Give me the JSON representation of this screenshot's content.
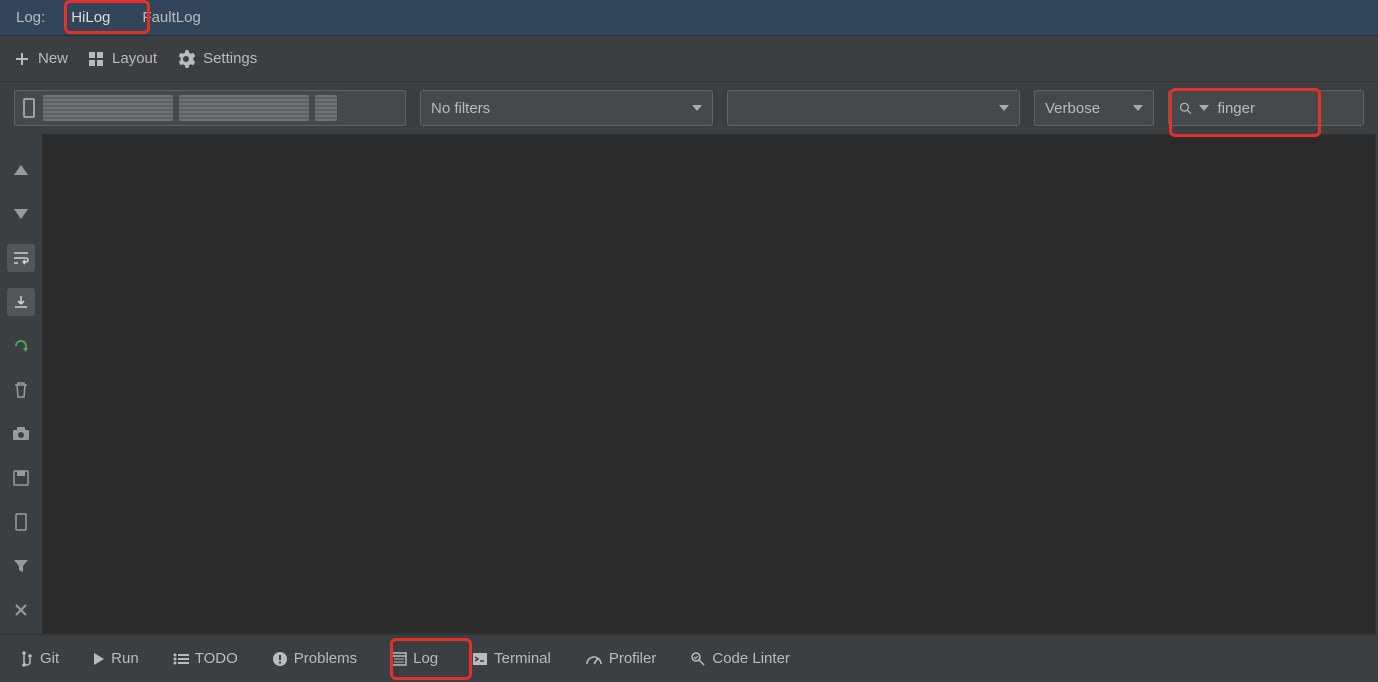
{
  "tabbar": {
    "label": "Log:",
    "tabs": [
      {
        "label": "HiLog",
        "active": true
      },
      {
        "label": "FaultLog",
        "active": false
      }
    ]
  },
  "toolbar": {
    "new_label": "New",
    "layout_label": "Layout",
    "settings_label": "Settings"
  },
  "filters": {
    "no_filters_label": "No filters",
    "verbose_label": "Verbose",
    "search_value": "finger"
  },
  "left_tools": {
    "icons": [
      "arrow-up-icon",
      "arrow-down-icon",
      "wrap-icon",
      "export-icon",
      "refresh-icon",
      "trash-icon",
      "camera-icon",
      "save-icon",
      "device-icon",
      "filter-icon",
      "close-icon"
    ]
  },
  "bottombar": {
    "git": "Git",
    "run": "Run",
    "todo": "TODO",
    "problems": "Problems",
    "log": "Log",
    "terminal": "Terminal",
    "profiler": "Profiler",
    "codelinter": "Code Linter"
  }
}
